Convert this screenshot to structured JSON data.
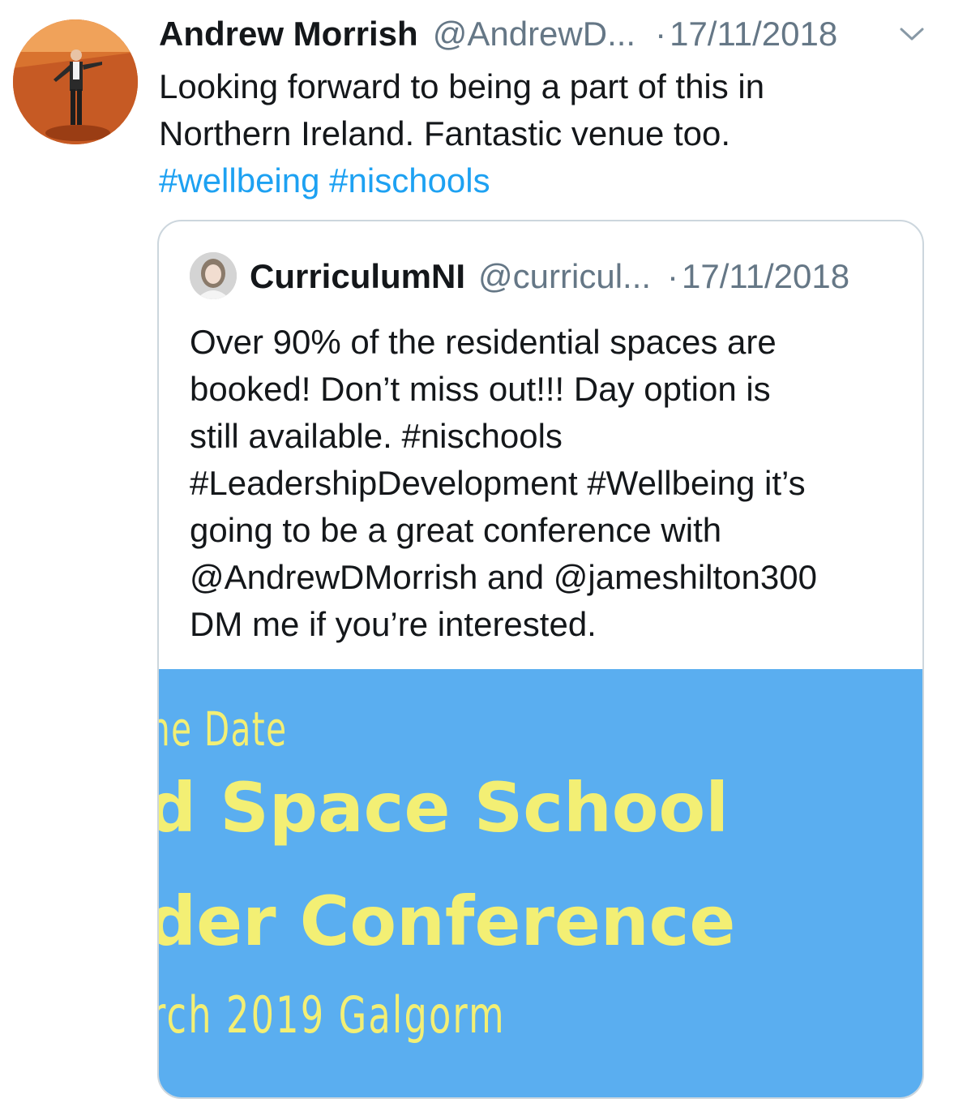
{
  "tweet": {
    "author_name": "Andrew Morrish",
    "author_handle": "@AndrewD...",
    "separator": "·",
    "date": "17/11/2018",
    "text_line1": "Looking forward to being a part of this in",
    "text_line2": "Northern Ireland. Fantastic venue too.",
    "hashtag1": "#wellbeing",
    "hashtag2": "#nischools",
    "menu_icon": "chevron-down-icon"
  },
  "quoted_tweet": {
    "author_name": "CurriculumNI",
    "author_handle": "@curricul...",
    "separator": "·",
    "date": "17/11/2018",
    "lines": [
      "Over 90% of the residential spaces are",
      "booked! Don’t miss out!!! Day option is",
      "still available. #nischools",
      "#LeadershipDevelopment #Wellbeing it’s",
      "going to be a great conference with",
      "@AndrewDMorrish and @jameshilton300",
      "DM me if you’re interested."
    ],
    "image": {
      "line1": "he Date",
      "line2": "d Space School",
      "line3": "der Conference",
      "line4": "rch 2019 Galgorm"
    }
  },
  "colors": {
    "link": "#1da1f2",
    "muted": "#657786",
    "text": "#14171a",
    "image_bg": "#5aaef0",
    "image_text": "#f3ef74"
  }
}
